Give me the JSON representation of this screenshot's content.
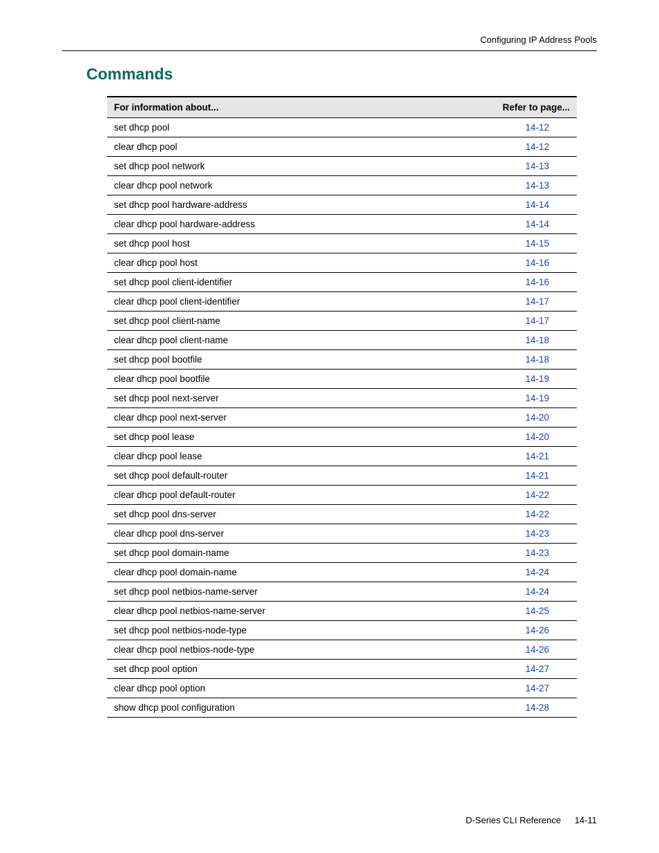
{
  "header": {
    "breadcrumb": "Configuring IP Address Pools"
  },
  "section": {
    "title": "Commands"
  },
  "table": {
    "col_info": "For information about...",
    "col_page": "Refer to page...",
    "rows": [
      {
        "name": "set dhcp pool",
        "page": "14-12"
      },
      {
        "name": "clear dhcp pool",
        "page": "14-12"
      },
      {
        "name": "set dhcp pool network",
        "page": "14-13"
      },
      {
        "name": "clear dhcp pool network",
        "page": "14-13"
      },
      {
        "name": "set dhcp pool hardware-address",
        "page": "14-14"
      },
      {
        "name": "clear dhcp pool hardware-address",
        "page": "14-14"
      },
      {
        "name": "set dhcp pool host",
        "page": "14-15"
      },
      {
        "name": "clear dhcp pool host",
        "page": "14-16"
      },
      {
        "name": "set dhcp pool client-identifier",
        "page": "14-16"
      },
      {
        "name": "clear dhcp pool client-identifier",
        "page": "14-17"
      },
      {
        "name": "set dhcp pool client-name",
        "page": "14-17"
      },
      {
        "name": "clear dhcp pool client-name",
        "page": "14-18"
      },
      {
        "name": "set dhcp pool bootfile",
        "page": "14-18"
      },
      {
        "name": "clear dhcp pool bootfile",
        "page": "14-19"
      },
      {
        "name": "set dhcp pool next-server",
        "page": "14-19"
      },
      {
        "name": "clear dhcp pool next-server",
        "page": "14-20"
      },
      {
        "name": "set dhcp pool lease",
        "page": "14-20"
      },
      {
        "name": "clear dhcp pool lease",
        "page": "14-21"
      },
      {
        "name": "set dhcp pool default-router",
        "page": "14-21"
      },
      {
        "name": "clear dhcp pool default-router",
        "page": "14-22"
      },
      {
        "name": "set dhcp pool dns-server",
        "page": "14-22"
      },
      {
        "name": "clear dhcp pool dns-server",
        "page": "14-23"
      },
      {
        "name": "set dhcp pool domain-name",
        "page": "14-23"
      },
      {
        "name": "clear dhcp pool domain-name",
        "page": "14-24"
      },
      {
        "name": "set dhcp pool netbios-name-server",
        "page": "14-24"
      },
      {
        "name": "clear dhcp pool netbios-name-server",
        "page": "14-25"
      },
      {
        "name": "set dhcp pool netbios-node-type",
        "page": "14-26"
      },
      {
        "name": "clear dhcp pool netbios-node-type",
        "page": "14-26"
      },
      {
        "name": "set dhcp pool option",
        "page": "14-27"
      },
      {
        "name": "clear dhcp pool option",
        "page": "14-27"
      },
      {
        "name": "show dhcp pool configuration",
        "page": "14-28"
      }
    ]
  },
  "footer": {
    "doc_name": "D-Series CLI Reference",
    "page_number": "14-11"
  }
}
